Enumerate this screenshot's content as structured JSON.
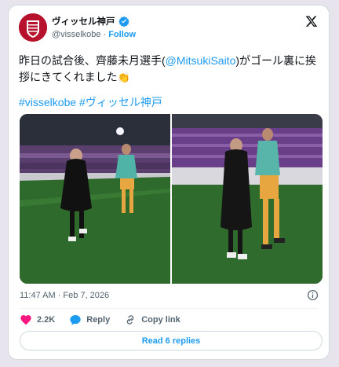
{
  "author": {
    "display_name": "ヴィッセル神戸",
    "handle": "@visselkobe",
    "separator": "·",
    "follow_label": "Follow"
  },
  "tweet": {
    "text_before_mention": "昨日の試合後、齊藤未月選手(",
    "mention": "@MitsukiSaito",
    "text_after_mention": ")がゴール裏に挨拶にきてくれました",
    "emoji": "👏",
    "hashtag_1": "#visselkobe",
    "hashtag_2": "#ヴィッセル神戸"
  },
  "meta": {
    "timestamp": "11:47 AM · Feb 7, 2026"
  },
  "actions": {
    "like_count": "2.2K",
    "reply_label": "Reply",
    "copy_link_label": "Copy link"
  },
  "footer": {
    "read_replies_label": "Read 6 replies"
  },
  "colors": {
    "accent": "#1d9bf0",
    "brand": "#b7122d",
    "like": "#f91880"
  }
}
